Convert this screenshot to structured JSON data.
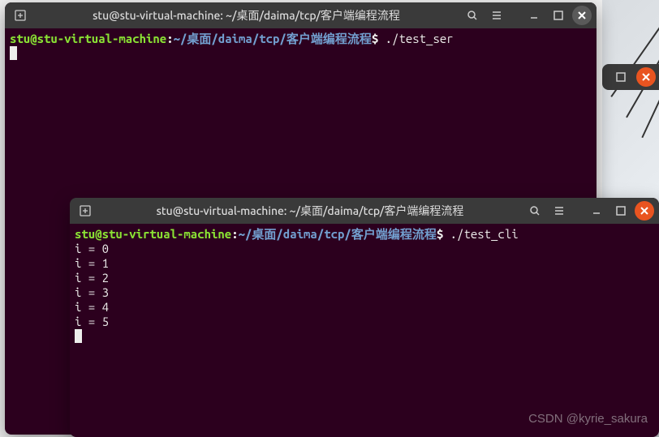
{
  "terminal1": {
    "title": "stu@stu-virtual-machine: ~/桌面/daima/tcp/客户端编程流程",
    "user": "stu",
    "host": "stu-virtual-machine",
    "path": "~/桌面/daima/tcp/客户端编程流程",
    "command": "./test_ser",
    "output_lines": []
  },
  "terminal2": {
    "title": "stu@stu-virtual-machine: ~/桌面/daima/tcp/客户端编程流程",
    "user": "stu",
    "host": "stu-virtual-machine",
    "path": "~/桌面/daima/tcp/客户端编程流程",
    "command": "./test_cli",
    "output_lines": [
      " i = 0",
      " i = 1",
      " i = 2",
      " i = 3",
      " i = 4",
      " i = 5"
    ]
  },
  "watermark": "CSDN @kyrie_sakura",
  "icons": {
    "new_tab": "⊞",
    "search": "search",
    "menu": "≡",
    "minimize": "—",
    "maximize": "□",
    "close": "×"
  }
}
